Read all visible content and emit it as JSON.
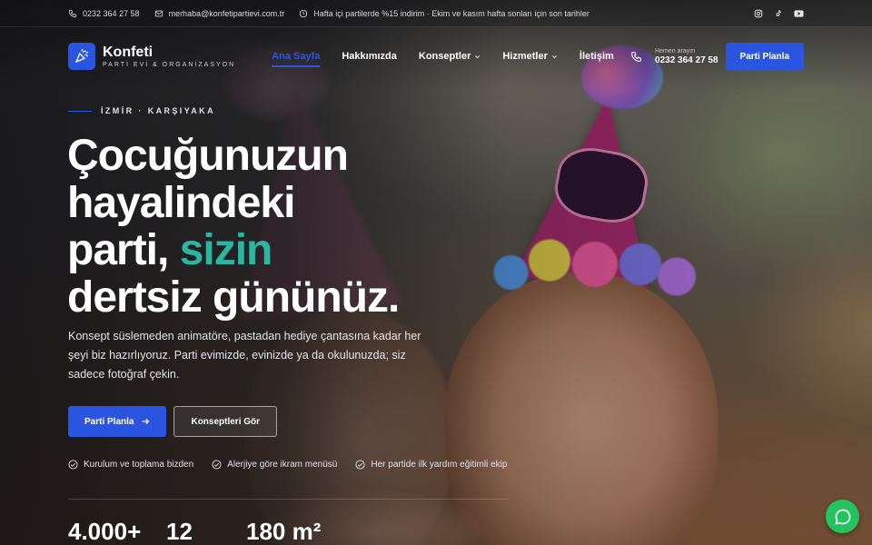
{
  "topbar": {
    "phone": "0232 364 27 58",
    "email": "merhaba@konfetipartievi.com.tr",
    "promo": "Hafta içi partilerde %15 indirim · Ekim ve kasım hafta sonları için son tarihler",
    "social_icons": [
      "instagram-icon",
      "tiktok-icon",
      "youtube-icon"
    ]
  },
  "brand": {
    "name": "Konfeti",
    "tagline": "PARTİ EVİ & ORGANİZASYON",
    "accent_color": "#2a55e0",
    "highlight_color": "#2bb6a3"
  },
  "nav": {
    "items": [
      {
        "label": "Ana Sayfa",
        "active": true
      },
      {
        "label": "Hakkımızda"
      },
      {
        "label": "Konseptler",
        "dropdown": true
      },
      {
        "label": "Hizmetler",
        "dropdown": true
      },
      {
        "label": "İletişim"
      }
    ],
    "call_caption": "Hemen arayın",
    "call_number": "0232 364 27 58",
    "cta": "Parti Planla"
  },
  "hero": {
    "eyebrow": "İZMİR · KARŞIYAKA",
    "headline_line1": "Çocuğunuzun",
    "headline_line2": "hayalindeki",
    "headline_line3a": "parti, ",
    "headline_accent": "sizin",
    "headline_line4": "dertsiz gününüz.",
    "lead": "Konsept süslemeden animatöre, pastadan hediye çantasına kadar her şeyi biz hazırlıyoruz. Parti evimizde, evinizde ya da okulunuzda; siz sadece fotoğraf çekin.",
    "primary_cta": "Parti Planla",
    "secondary_cta": "Konseptleri Gör",
    "checks": [
      "Kurulum ve toplama bizden",
      "Alerjiye göre ikram menüsü",
      "Her partide ilk yardım eğitimli ekip"
    ],
    "stats": [
      "4.000+",
      "12",
      "180 m²"
    ]
  },
  "whatsapp_icon": "whatsapp-icon"
}
